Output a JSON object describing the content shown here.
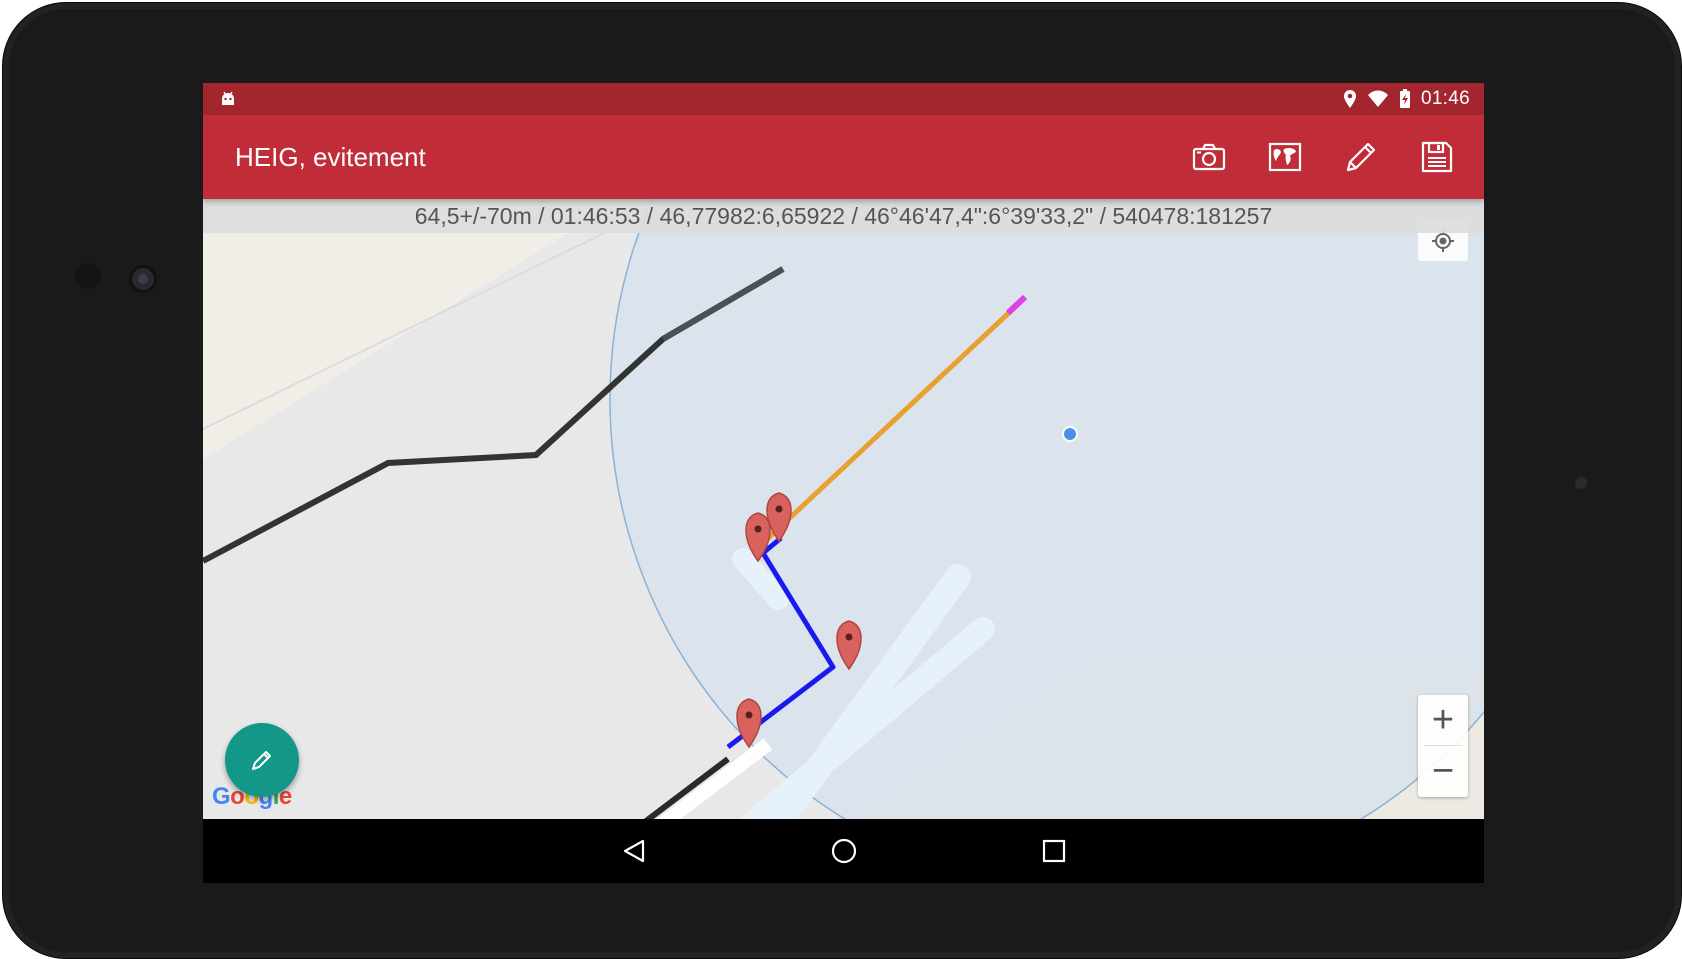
{
  "status_bar": {
    "time": "01:46",
    "left_icon": "android-debug-icon",
    "right_icons": [
      "location-icon",
      "wifi-icon",
      "battery-charging-icon"
    ]
  },
  "app_bar": {
    "title": "HEIG, evitement",
    "actions": [
      {
        "name": "camera-button",
        "icon": "camera-icon"
      },
      {
        "name": "map-layers-button",
        "icon": "world-map-icon"
      },
      {
        "name": "edit-button",
        "icon": "pencil-icon"
      },
      {
        "name": "save-button",
        "icon": "floppy-disk-icon"
      }
    ],
    "color": "#c02d38"
  },
  "info_bar": {
    "text": "64,5+/-70m / 01:46:53 / 46,77982:6,65922 / 46°46'47,4\":6°39'33,2\" / 540478:181257"
  },
  "map": {
    "attribution": "Google",
    "zoom_in_label": "+",
    "zoom_out_label": "−",
    "track_colors": {
      "blue": "#1a1aee",
      "orange": "#e8a030",
      "magenta": "#e040e0",
      "road": "#333333"
    },
    "markers_count": 4
  },
  "fab": {
    "icon": "pencil-icon",
    "color": "#129788"
  },
  "nav_bar": {
    "buttons": [
      "back-icon",
      "home-icon",
      "recents-icon"
    ]
  }
}
